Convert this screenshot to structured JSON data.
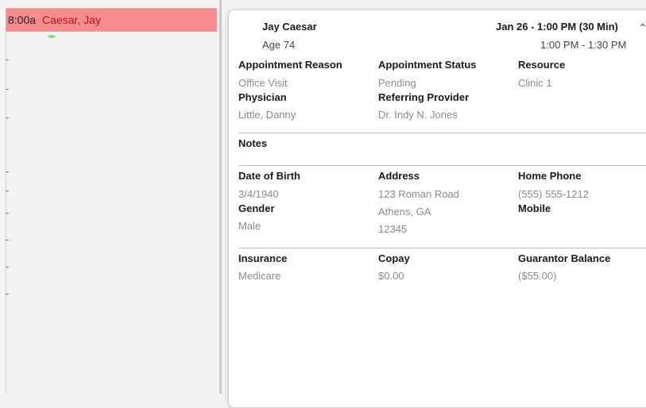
{
  "appointment_slot": {
    "time": "8:00a",
    "patient": "Caesar, Jay"
  },
  "header": {
    "patient_name": "Jay Caesar",
    "age": "Age 74",
    "date_duration": "Jan 26 - 1:00 PM (30 Min)",
    "time_range": "1:00 PM - 1:30 PM"
  },
  "appointment": {
    "reason_label": "Appointment Reason",
    "reason": "Office Visit",
    "status_label": "Appointment Status",
    "status": "Pending",
    "resource_label": "Resource",
    "resource": "Clinic 1",
    "physician_label": "Physician",
    "physician": "Little, Danny",
    "referring_label": "Referring Provider",
    "referring": "Dr. Indy N. Jones"
  },
  "notes": {
    "label": "Notes"
  },
  "demographics": {
    "dob_label": "Date of Birth",
    "dob": "3/4/1940",
    "address_label": "Address",
    "address_line1": "123 Roman Road",
    "address_line2": "Athens, GA",
    "address_line3": "12345",
    "home_phone_label": "Home Phone",
    "home_phone": "(555) 555-1212",
    "gender_label": "Gender",
    "gender": "Male",
    "mobile_label": "Mobile"
  },
  "billing": {
    "insurance_label": "Insurance",
    "insurance": "Medicare",
    "copay_label": "Copay",
    "copay": "$0.00",
    "guarantor_label": "Guarantor Balance",
    "guarantor": "($55.00)"
  },
  "colors": {
    "appointment_bg": "#f58c8e",
    "appointment_text": "#b11a1a"
  },
  "icons": {
    "collapse": "chevron-up-icon"
  }
}
